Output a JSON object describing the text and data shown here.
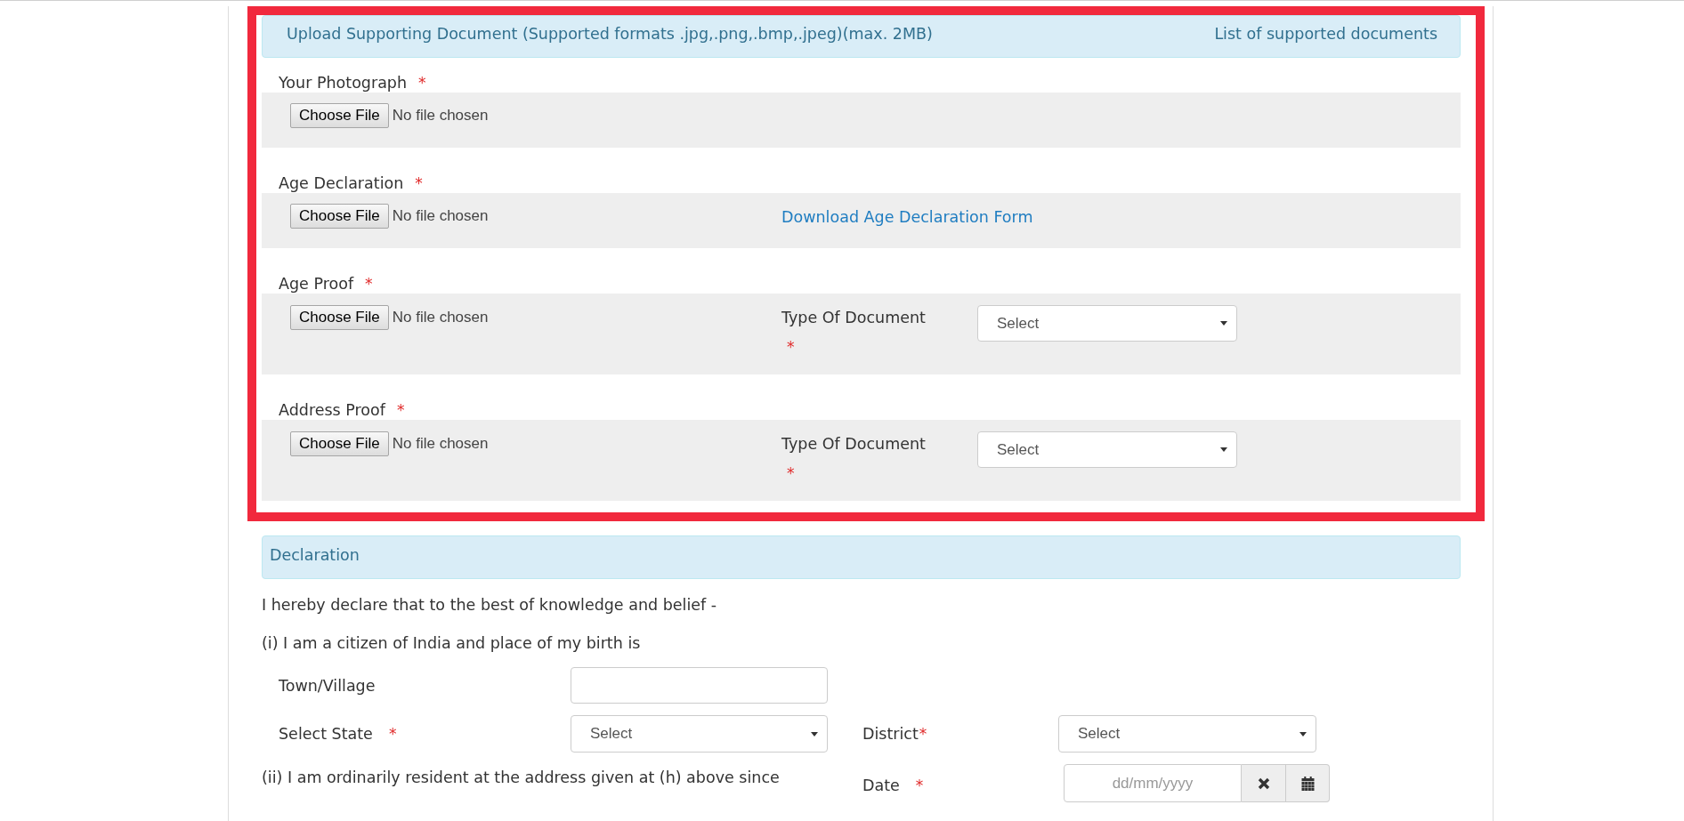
{
  "upload_section": {
    "highlighted": true,
    "title": "Upload Supporting Document (Supported formats .jpg,.png,.bmp,.jpeg)(max. 2MB)",
    "link": "List of supported documents",
    "fields": [
      {
        "kind": "plain",
        "label": "Your Photograph",
        "required_mark": "*",
        "button": "Choose File",
        "file_status": "No file chosen"
      },
      {
        "kind": "download",
        "label": "Age Declaration",
        "required_mark": "*",
        "button": "Choose File",
        "file_status": "No file chosen",
        "link": "Download Age Declaration Form"
      },
      {
        "kind": "document_type",
        "label": "Age Proof",
        "required_mark": "*",
        "button": "Choose File",
        "file_status": "No file chosen",
        "document_type": {
          "label": "Type Of Document",
          "required_mark": "*",
          "value": "Select"
        }
      },
      {
        "kind": "document_type",
        "label": "Address Proof",
        "required_mark": "*",
        "button": "Choose File",
        "file_status": "No file chosen",
        "document_type": {
          "label": "Type Of Document",
          "required_mark": "*",
          "value": "Select"
        }
      }
    ]
  },
  "declaration": {
    "title": "Declaration",
    "statement": "I hereby declare that to the best of knowledge and belief -",
    "clause_i": "(i) I am a citizen of India and place of my birth is",
    "town_village": {
      "label": "Town/Village"
    },
    "state": {
      "label": "Select State",
      "required_mark": "*",
      "value": "Select"
    },
    "district": {
      "label": "District",
      "required_mark": "*",
      "value": "Select"
    },
    "clause_ii": "(ii) I am ordinarily resident at the address given at (h) above since",
    "date": {
      "label": "Date",
      "required_mark": "*",
      "placeholder": "dd/mm/yyyy"
    }
  }
}
